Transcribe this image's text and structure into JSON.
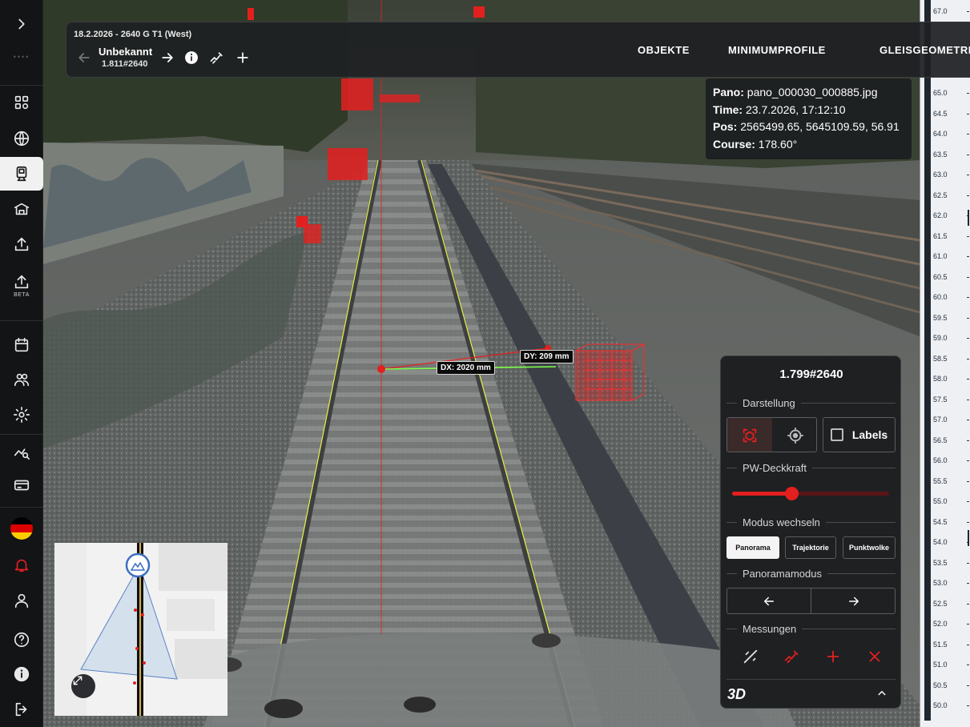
{
  "toolbar": {
    "title": "18.2.2026 - 2640 G T1 (West)",
    "current_name": "Unbekannt",
    "current_id": "1.811#2640",
    "nav": [
      "OBJEKTE",
      "MINIMUMPROFILE",
      "GLEISGEOMETRIE"
    ]
  },
  "info": {
    "pano_label": "Pano:",
    "pano_value": "pano_000030_000885.jpg",
    "time_label": "Time:",
    "time_value": "23.7.2026, 17:12:10",
    "pos_label": "Pos:",
    "pos_value": "2565499.65, 5645109.59, 56.91",
    "course_label": "Course:",
    "course_value": "178.60°"
  },
  "measurement": {
    "dx_label": "DX: 2020 mm",
    "dy_label": "DY: 209 mm"
  },
  "panel": {
    "title": "1.799#2640",
    "section_darstellung": "Darstellung",
    "labels_checkbox": "Labels",
    "labels_checked": false,
    "section_deckkraft": "PW-Deckkraft",
    "deckkraft_level": 0.38,
    "section_modus": "Modus wechseln",
    "modes": [
      "Panorama",
      "Trajektorie",
      "Punktwolke"
    ],
    "active_mode": "Panorama",
    "section_panoramamodus": "Panoramamodus",
    "section_messungen": "Messungen",
    "footer": "3D"
  },
  "sidebar": {
    "beta_label": "BETA",
    "dots": "••••"
  },
  "scale": {
    "ticks": [
      "67.0",
      "65.0",
      "64.5",
      "64.0",
      "63.5",
      "63.0",
      "62.5",
      "62.0",
      "61.5",
      "61.0",
      "60.5",
      "60.0",
      "59.5",
      "59.0",
      "58.5",
      "58.0",
      "57.5",
      "57.0",
      "56.5",
      "56.0",
      "55.5",
      "55.0",
      "54.5",
      "54.0",
      "53.5",
      "53.0",
      "52.5",
      "52.0",
      "51.5",
      "51.0",
      "50.5",
      "50.0"
    ]
  },
  "colors": {
    "accent_red": "#e41f1f",
    "measure_green": "#7dff4a",
    "track_yellow": "#e8f04a"
  }
}
